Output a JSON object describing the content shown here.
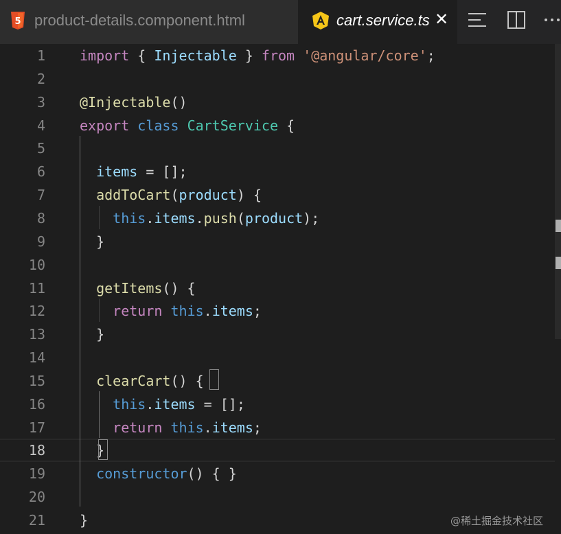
{
  "tabs": [
    {
      "label": "product-details.component.html",
      "icon": "html5-icon",
      "active": false
    },
    {
      "label": "cart.service.ts",
      "icon": "angular-icon",
      "active": true,
      "close_glyph": "✕"
    }
  ],
  "editor_actions": [
    "split-menu-icon",
    "split-editor-icon",
    "more-actions-icon"
  ],
  "current_line": 18,
  "lines": [
    {
      "n": "1",
      "tokens": [
        [
          "kw-flow",
          "import"
        ],
        [
          "punc",
          " { "
        ],
        [
          "var",
          "Injectable"
        ],
        [
          "punc",
          " } "
        ],
        [
          "kw-flow",
          "from"
        ],
        [
          "punc",
          " "
        ],
        [
          "str",
          "'@angular/core'"
        ],
        [
          "punc",
          ";"
        ]
      ]
    },
    {
      "n": "2",
      "tokens": []
    },
    {
      "n": "3",
      "tokens": [
        [
          "fn",
          "@Injectable"
        ],
        [
          "punc",
          "()"
        ]
      ]
    },
    {
      "n": "4",
      "tokens": [
        [
          "kw-flow",
          "export"
        ],
        [
          "punc",
          " "
        ],
        [
          "kw",
          "class"
        ],
        [
          "punc",
          " "
        ],
        [
          "cls",
          "CartService"
        ],
        [
          "punc",
          " {"
        ]
      ]
    },
    {
      "n": "5",
      "tokens": []
    },
    {
      "n": "6",
      "tokens": [
        [
          "punc",
          "  "
        ],
        [
          "var",
          "items"
        ],
        [
          "punc",
          " = [];"
        ]
      ]
    },
    {
      "n": "7",
      "tokens": [
        [
          "punc",
          "  "
        ],
        [
          "fn",
          "addToCart"
        ],
        [
          "punc",
          "("
        ],
        [
          "var",
          "product"
        ],
        [
          "punc",
          ") {"
        ]
      ]
    },
    {
      "n": "8",
      "tokens": [
        [
          "punc",
          "    "
        ],
        [
          "kw",
          "this"
        ],
        [
          "punc",
          "."
        ],
        [
          "var",
          "items"
        ],
        [
          "punc",
          "."
        ],
        [
          "fn",
          "push"
        ],
        [
          "punc",
          "("
        ],
        [
          "var",
          "product"
        ],
        [
          "punc",
          ");"
        ]
      ]
    },
    {
      "n": "9",
      "tokens": [
        [
          "punc",
          "  }"
        ]
      ]
    },
    {
      "n": "10",
      "tokens": []
    },
    {
      "n": "11",
      "tokens": [
        [
          "punc",
          "  "
        ],
        [
          "fn",
          "getItems"
        ],
        [
          "punc",
          "() {"
        ]
      ]
    },
    {
      "n": "12",
      "tokens": [
        [
          "punc",
          "    "
        ],
        [
          "kw-flow",
          "return"
        ],
        [
          "punc",
          " "
        ],
        [
          "kw",
          "this"
        ],
        [
          "punc",
          "."
        ],
        [
          "var",
          "items"
        ],
        [
          "punc",
          ";"
        ]
      ]
    },
    {
      "n": "13",
      "tokens": [
        [
          "punc",
          "  }"
        ]
      ]
    },
    {
      "n": "14",
      "tokens": []
    },
    {
      "n": "15",
      "tokens": [
        [
          "punc",
          "  "
        ],
        [
          "fn",
          "clearCart"
        ],
        [
          "punc",
          "() {"
        ]
      ]
    },
    {
      "n": "16",
      "tokens": [
        [
          "punc",
          "    "
        ],
        [
          "kw",
          "this"
        ],
        [
          "punc",
          "."
        ],
        [
          "var",
          "items"
        ],
        [
          "punc",
          " = [];"
        ]
      ]
    },
    {
      "n": "17",
      "tokens": [
        [
          "punc",
          "    "
        ],
        [
          "kw-flow",
          "return"
        ],
        [
          "punc",
          " "
        ],
        [
          "kw",
          "this"
        ],
        [
          "punc",
          "."
        ],
        [
          "var",
          "items"
        ],
        [
          "punc",
          ";"
        ]
      ]
    },
    {
      "n": "18",
      "tokens": [
        [
          "punc",
          "  }"
        ]
      ]
    },
    {
      "n": "19",
      "tokens": [
        [
          "punc",
          "  "
        ],
        [
          "kw",
          "constructor"
        ],
        [
          "punc",
          "() { }"
        ]
      ]
    },
    {
      "n": "20",
      "tokens": []
    },
    {
      "n": "21",
      "tokens": [
        [
          "punc",
          "}"
        ]
      ]
    }
  ],
  "watermark": "@稀土掘金技术社区",
  "colors": {
    "background": "#1e1e1e",
    "tabbar": "#252526",
    "keyword_flow": "#c586c0",
    "keyword": "#569cd6",
    "class": "#4ec9b0",
    "string": "#ce9178",
    "function": "#dcdcaa",
    "variable": "#9cdcfe",
    "html5": "#e44d26",
    "angular": "#f5c518"
  }
}
